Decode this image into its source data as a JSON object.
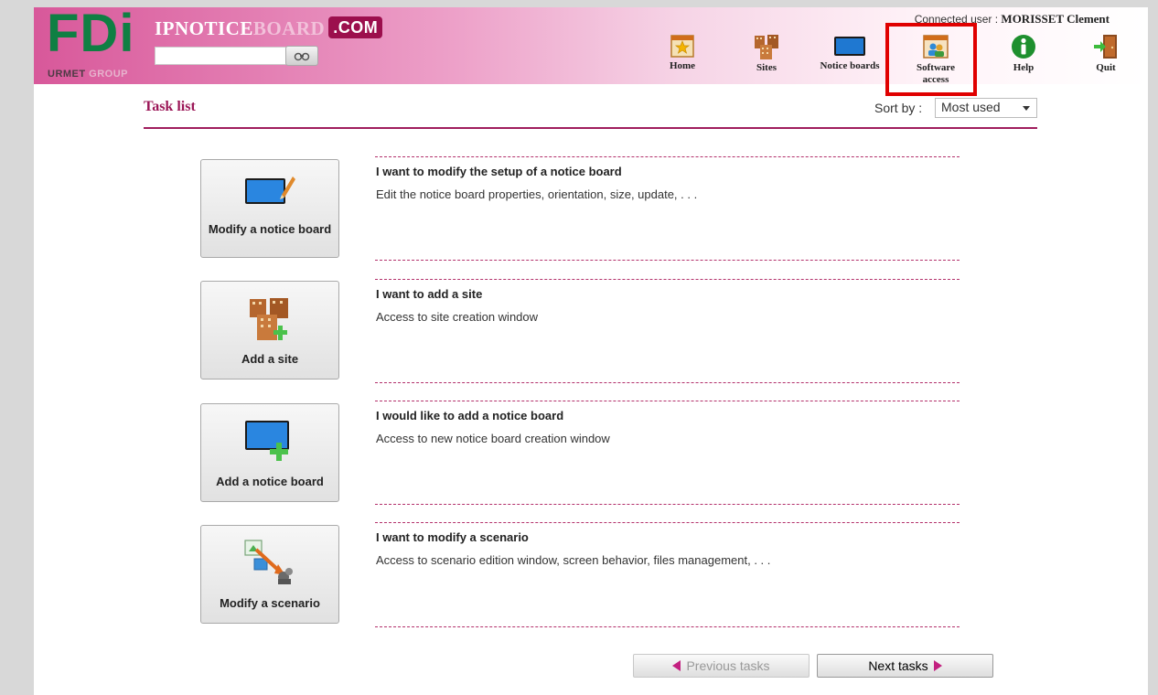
{
  "header": {
    "logo_main": "FDi",
    "logo_sub": "URMET",
    "logo_sub_faded": "GROUP",
    "brand_a": "IPNOTICE",
    "brand_b": "BOARD",
    "brand_com": ".COM",
    "search_value": "",
    "connected_label": "Connected user :",
    "connected_user": "MORISSET Clement",
    "nav": [
      {
        "label": "Home",
        "icon": "home-star-icon"
      },
      {
        "label": "Sites",
        "icon": "buildings-icon"
      },
      {
        "label": "Notice boards",
        "icon": "screen-icon"
      },
      {
        "label": "Software access",
        "icon": "software-users-icon"
      },
      {
        "label": "Help",
        "icon": "info-icon"
      },
      {
        "label": "Quit",
        "icon": "exit-door-icon"
      }
    ]
  },
  "task_list": {
    "title": "Task list",
    "sort_label": "Sort by :",
    "sort_value": "Most used",
    "tasks": [
      {
        "button": "Modify a notice board",
        "heading": "I want to modify the setup of a notice board",
        "desc": "Edit the notice board properties, orientation, size, update, . . ."
      },
      {
        "button": "Add a site",
        "heading": "I want to add a site",
        "desc": "Access to site creation window"
      },
      {
        "button": "Add a notice board",
        "heading": "I would like to add a notice board",
        "desc": "Access to new notice board creation window"
      },
      {
        "button": "Modify a scenario",
        "heading": "I want to modify a scenario",
        "desc": "Access to scenario edition window, screen behavior, files management, . . ."
      }
    ]
  },
  "pager": {
    "prev": "Previous tasks",
    "next": "Next tasks"
  },
  "colors": {
    "accent": "#9b1657",
    "logo_green": "#0f7f43",
    "highlight": "#e00000"
  }
}
